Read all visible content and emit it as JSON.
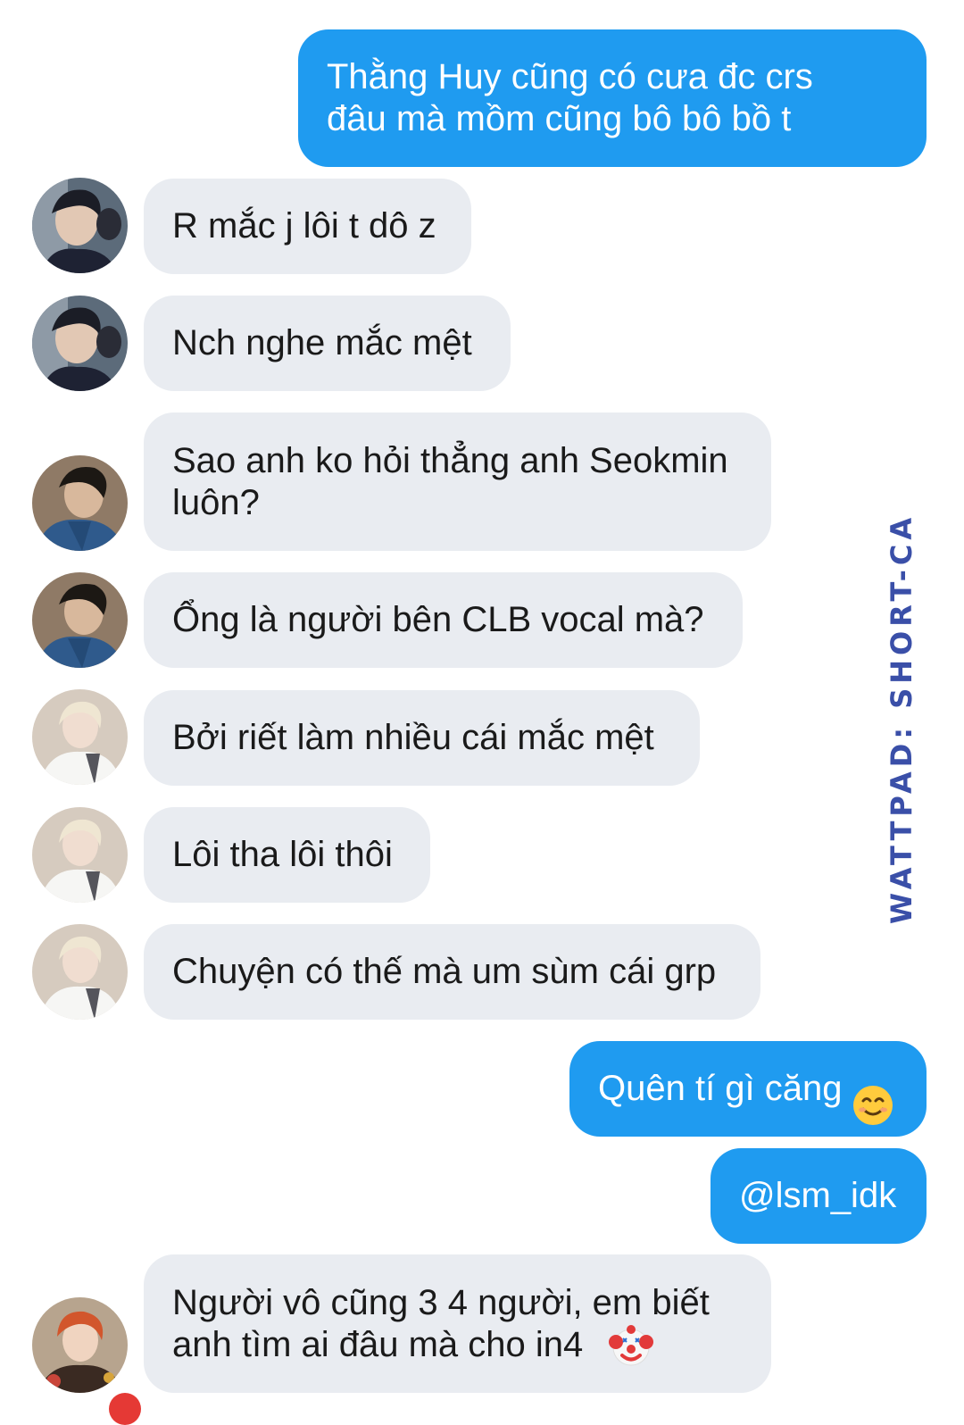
{
  "watermark": "WATTPAD: SHORT-CA",
  "messages": [
    {
      "sender": "me",
      "text": "Thằng Huy cũng có cưa đc crs\nđâu mà mồm cũng bô bô bồ t"
    },
    {
      "sender": "other",
      "text": "R mắc j lôi t dô z"
    },
    {
      "sender": "other",
      "text": "Nch nghe mắc mệt"
    },
    {
      "sender": "other",
      "text": "Sao anh ko hỏi thẳng anh Seokmin\nluôn?"
    },
    {
      "sender": "other",
      "text": "Ổng là người bên CLB vocal mà?"
    },
    {
      "sender": "other",
      "text": "Bởi riết làm nhiều cái mắc mệt"
    },
    {
      "sender": "other",
      "text": "Lôi tha lôi thôi"
    },
    {
      "sender": "other",
      "text": "Chuyện có thế mà um sùm cái grp"
    },
    {
      "sender": "me",
      "text": "Quên tí gì căng",
      "emoji": "smiling-face-emoji"
    },
    {
      "sender": "me",
      "text": "@lsm_idk"
    },
    {
      "sender": "other",
      "text": "Người vô cũng 3 4 người, em biết\nanh tìm ai đâu mà cho in4",
      "emoji": "clown-face-emoji"
    }
  ],
  "colors": {
    "outgoing_bubble": "#1f9bf0",
    "incoming_bubble": "#e9ecf1",
    "watermark": "#3a4fa8"
  }
}
